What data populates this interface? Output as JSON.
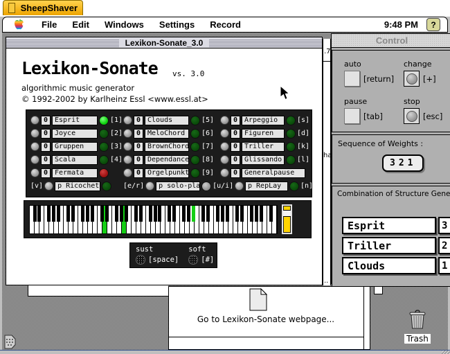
{
  "host": {
    "tab_title": "SheepShaver",
    "clock": "9:48 PM",
    "help_icon": "?",
    "trash_label": "Trash"
  },
  "menu_bar": {
    "items": [
      "File",
      "Edit",
      "Windows",
      "Settings",
      "Record"
    ]
  },
  "background_fragments": {
    "top": ".7",
    "middle": "ha",
    "bottom": ".."
  },
  "main_window": {
    "title": "Lexikon-Sonate_3.0",
    "heading": "Lexikon-Sonate",
    "version": "vs. 3.0",
    "subtitle": "algorithmic music generator",
    "copyright": "© 1992-2002 by Karlheinz Essl <www.essl.at>",
    "generators": {
      "columns": [
        {
          "rows": [
            {
              "count": "0",
              "label": "Esprit",
              "led": "on",
              "key": "[1]"
            },
            {
              "count": "0",
              "label": "Joyce",
              "led": "off",
              "key": "[2]"
            },
            {
              "count": "0",
              "label": "Gruppen",
              "led": "off",
              "key": "[3]"
            },
            {
              "count": "0",
              "label": "Scala",
              "led": "off",
              "key": "[4]"
            },
            {
              "count": "0",
              "label": "Fermata",
              "led": "red",
              "key": null
            },
            {
              "prefix": "[v]",
              "count": null,
              "label": "p Ricochet",
              "led": "off",
              "key": null
            }
          ]
        },
        {
          "rows": [
            {
              "count": "0",
              "label": "Clouds",
              "led": "off",
              "key": "[5]"
            },
            {
              "count": "0",
              "label": "MeloChord",
              "led": "off",
              "key": "[6]"
            },
            {
              "count": "0",
              "label": "BrownChord",
              "led": "off",
              "key": "[7]"
            },
            {
              "count": "0",
              "label": "Dependance",
              "led": "off",
              "key": "[8]"
            },
            {
              "count": "0",
              "label": "Orgelpunkt",
              "led": "off",
              "key": "[9]"
            },
            {
              "prefix": "[e/r]",
              "count": null,
              "label": "p solo-play",
              "led": "gray",
              "key": "[u/i]"
            }
          ]
        },
        {
          "rows": [
            {
              "count": "0",
              "label": "Arpeggio",
              "led": "off",
              "key": "[s]"
            },
            {
              "count": "0",
              "label": "Figuren",
              "led": "off",
              "key": "[d]"
            },
            {
              "count": "0",
              "label": "Triller",
              "led": "off",
              "key": "[k]"
            },
            {
              "count": "0",
              "label": "Glissando",
              "led": "off",
              "key": "[l]"
            },
            {
              "count": "0",
              "label": "Generalpause",
              "led": null,
              "key": null
            },
            {
              "prefix": null,
              "count": null,
              "label": "p RepLay",
              "led": "off",
              "key": "[n]"
            }
          ]
        }
      ]
    },
    "keyboard": {
      "white_key_count": 51,
      "green_white_keys": [
        15,
        19
      ],
      "green_black_keys_after": [
        33
      ],
      "slider_color": "#ffd400"
    },
    "pedals": [
      {
        "label": "sust",
        "key": "[space]"
      },
      {
        "label": "soft",
        "key": "[#]"
      }
    ]
  },
  "control_window": {
    "title": "Control",
    "buttons": [
      {
        "label": "auto",
        "key": "[return]",
        "type": "square"
      },
      {
        "label": "change",
        "key": "[+]",
        "type": "round"
      },
      {
        "label": "pause",
        "key": "[tab]",
        "type": "square"
      },
      {
        "label": "stop",
        "key": "[esc]",
        "type": "round"
      }
    ],
    "weights": {
      "label": "Sequence of Weights :",
      "value": "321"
    },
    "combination": {
      "label": "Combination of Structure Generator",
      "rows": [
        {
          "name": "Esprit",
          "weight": "3"
        },
        {
          "name": "Triller",
          "weight": "2"
        },
        {
          "name": "Clouds",
          "weight": "1"
        }
      ]
    }
  },
  "webpage_window": {
    "link_text": "Go to Lexikon-Sonate webpage..."
  },
  "colors": {
    "led_on": "#10d410",
    "led_off": "#0a4c0a",
    "led_red": "#a01414",
    "led_gray": "#979797",
    "tab_orange": "#eda400",
    "slider_yellow": "#ffd400",
    "key_green": "#15cf15"
  }
}
